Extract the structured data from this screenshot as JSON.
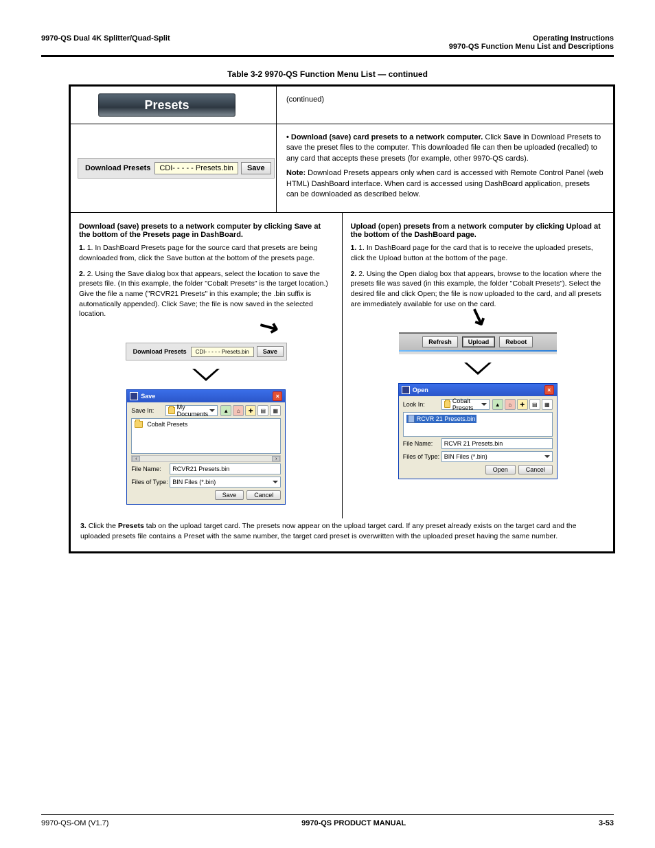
{
  "header": {
    "left": "9970-QS Dual 4K Splitter/Quad-Split",
    "right_top": "Operating Instructions",
    "right_bottom": "9970-QS Function Menu List and Descriptions"
  },
  "table_title": "Table 3-2    9970-QS Function Menu List  — continued",
  "row1": {
    "presets_tab": "Presets",
    "right_text": "(continued)"
  },
  "row2": {
    "left_label": "Download Presets",
    "left_file": "CDI- - - - -  Presets.bin",
    "left_save": "Save",
    "right_bold": "• Download (save) card presets to a network computer.",
    "right_para": "in Download Presets to save the preset files to the computer. This downloaded file can then be uploaded (recalled) to any card that accepts these presets (for example, other 9970-QS cards).",
    "right_note_label": "Note:",
    "right_note_text": "Download Presets appears only when card is accessed with Remote Control Panel (web HTML) DashBoard interface. When card is accessed using DashBoard application, presets can be downloaded as described below."
  },
  "left_half": {
    "title": "Download (save) presets to a network computer by clicking Save at the bottom of the Presets page in DashBoard.",
    "steps": [
      "1. In DashBoard Presets page for the source card that presets are being downloaded from, click the Save button at the bottom of the presets page.",
      "2. Using the Save dialog box that appears, select the location to save the presets file. (In this example, the folder \"Cobalt Presets\" is the target location.) Give the file a name (\"RCVR21 Presets\" in this example; the .bin suffix is automatically appended). Click Save; the file is now saved in the selected location."
    ],
    "strip": {
      "label": "Download Presets",
      "file": "CDI- - - - - Presets.bin",
      "save": "Save"
    },
    "dialog": {
      "title": "Save",
      "save_in_label": "Save In:",
      "save_in_value": "My Documents",
      "folder_item": "Cobalt Presets",
      "file_name_label": "File Name:",
      "file_name_value": "RCVR21 Presets.bin",
      "files_type_label": "Files of Type:",
      "files_type_value": "BIN Files (*.bin)",
      "btn_save": "Save",
      "btn_cancel": "Cancel"
    }
  },
  "right_half": {
    "title": "Upload (open) presets from a network computer by clicking Upload at the bottom of the DashBoard page.",
    "steps": [
      "1. In DashBoard page for the card that is to receive the uploaded presets, click the Upload button at the bottom of the page.",
      "2. Using the Open dialog box that appears, browse to the location where the presets file was saved (in this example, the folder \"Cobalt Presets\"). Select the desired file and click Open; the file is now uploaded to the card, and all presets are immediately available for use on the card."
    ],
    "bar": {
      "refresh": "Refresh",
      "upload": "Upload",
      "reboot": "Reboot"
    },
    "dialog": {
      "title": "Open",
      "look_in_label": "Look In:",
      "look_in_value": "Cobalt Presets",
      "selected_file": "RCVR 21 Presets.bin",
      "file_name_label": "File Name:",
      "file_name_value": "RCVR 21 Presets.bin",
      "files_type_label": "Files of Type:",
      "files_type_value": "BIN Files (*.bin)",
      "btn_open": "Open",
      "btn_cancel": "Cancel"
    }
  },
  "footnote": {
    "num": "3.",
    "text1": "Click the ",
    "bold": "Presets",
    "text2": " tab on the upload target card. The presets now appear on the upload target card. If any preset already exists on the target card and the uploaded presets file contains a Preset with the same number, the target card preset is overwritten with the uploaded preset having the same number."
  },
  "footer": {
    "left": "9970-QS-OM (V1.7)",
    "mid": "9970-QS PRODUCT MANUAL",
    "right": "3-53"
  }
}
